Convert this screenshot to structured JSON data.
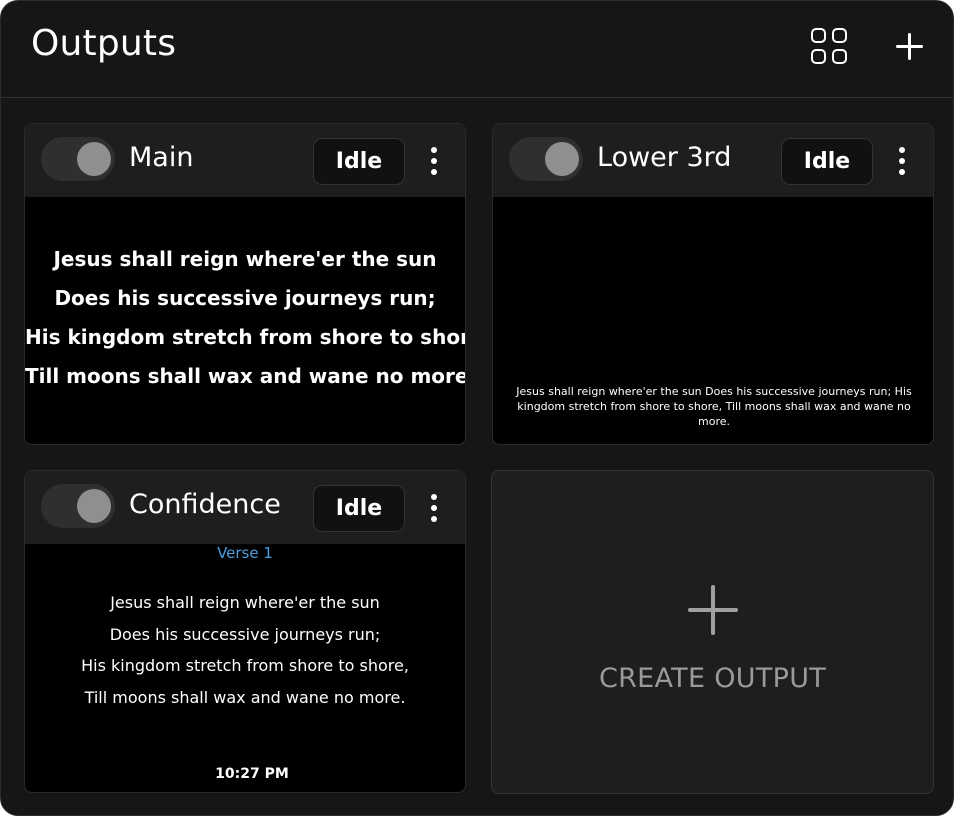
{
  "header": {
    "title": "Outputs",
    "grid_icon": "grid-view-icon",
    "add_icon": "plus-icon"
  },
  "outputs": [
    {
      "name": "Main",
      "status": "Idle",
      "enabled": false,
      "lyrics": [
        "Jesus shall reign where'er the sun",
        "Does his successive journeys run;",
        "His kingdom stretch from shore to shore,",
        "Till moons shall wax and wane no more."
      ]
    },
    {
      "name": "Lower 3rd",
      "status": "Idle",
      "enabled": false,
      "lyrics_line": "Jesus shall reign where'er the sun Does his successive journeys run; His kingdom stretch from shore to shore, Till moons shall wax and wane no more."
    },
    {
      "name": "Confidence",
      "status": "Idle",
      "enabled": false,
      "section_label": "Verse 1",
      "lyrics": [
        "Jesus shall reign where'er the sun",
        "Does his successive journeys run;",
        "His kingdom stretch from shore to shore,",
        "Till moons shall wax and wane no more."
      ],
      "clock": "10:27 PM"
    }
  ],
  "create": {
    "label": "CREATE OUTPUT",
    "icon": "plus-icon"
  },
  "colors": {
    "background": "#161616",
    "card_header": "#1e1e1e",
    "preview": "#000000",
    "section_label": "#4c9ee0",
    "muted": "#9a9a9a"
  }
}
